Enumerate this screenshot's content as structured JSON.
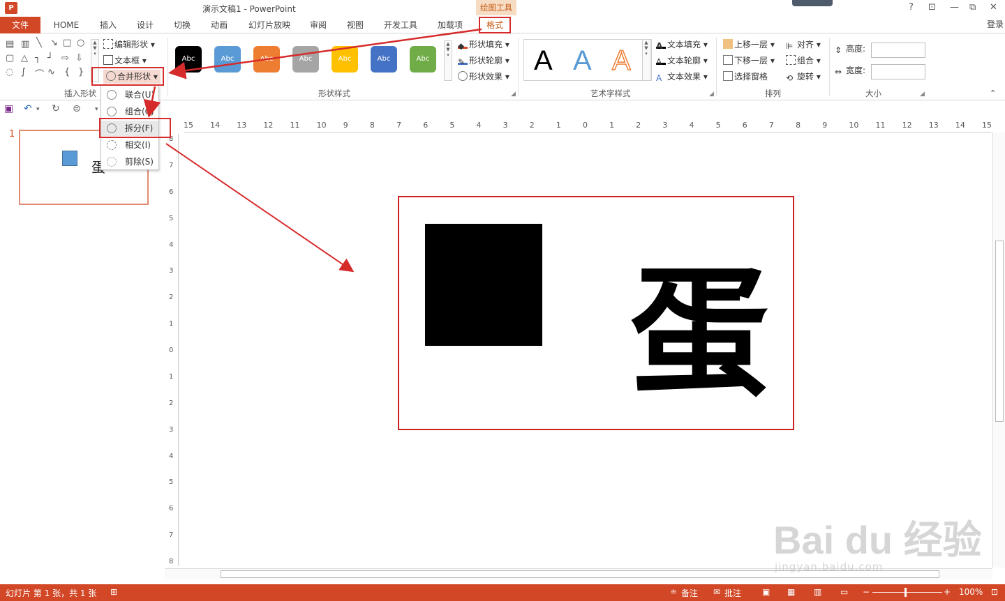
{
  "app": {
    "window_title": "演示文稿1 - PowerPoint",
    "context_tool_label": "绘图工具",
    "login": "登录",
    "logo_letter": "P",
    "help": "?",
    "restore": "⊡",
    "minimize": "—",
    "maximize": "⧉",
    "close": "✕"
  },
  "tabs": [
    {
      "label": "文件"
    },
    {
      "label": "HOME"
    },
    {
      "label": "插入"
    },
    {
      "label": "设计"
    },
    {
      "label": "切换"
    },
    {
      "label": "动画"
    },
    {
      "label": "幻灯片放映"
    },
    {
      "label": "审阅"
    },
    {
      "label": "视图"
    },
    {
      "label": "开发工具"
    },
    {
      "label": "加载项"
    },
    {
      "label": "格式"
    }
  ],
  "ribbon": {
    "insert_shapes": {
      "label": "插入形状",
      "edit_shape": "编辑形状",
      "text_box": "文本框",
      "merge_shapes": "合并形状"
    },
    "shape_styles": {
      "label": "形状样式",
      "swatch_text": "Abc",
      "swatches": [
        "#000000",
        "#5b9bd5",
        "#ed7d31",
        "#a5a5a5",
        "#ffc000",
        "#4472c4",
        "#70ad47"
      ],
      "fill": "形状填充",
      "outline": "形状轮廓",
      "effects": "形状效果"
    },
    "wordart": {
      "label": "艺术字样式",
      "letter": "A",
      "text_fill": "文本填充",
      "text_outline": "文本轮廓",
      "text_effects": "文本效果"
    },
    "arrange": {
      "label": "排列",
      "bring_forward": "上移一层",
      "send_backward": "下移一层",
      "selection_pane": "选择窗格",
      "align": "对齐",
      "group": "组合",
      "rotate": "旋转"
    },
    "size": {
      "label": "大小",
      "height": "高度:",
      "width": "宽度:"
    }
  },
  "merge_menu": [
    {
      "label": "联合(U)"
    },
    {
      "label": "组合(C)"
    },
    {
      "label": "拆分(F)"
    },
    {
      "label": "相交(I)"
    },
    {
      "label": "剪除(S)"
    }
  ],
  "thumbnails": {
    "slide_number": "1",
    "char": "蛋"
  },
  "slide": {
    "char": "蛋"
  },
  "rulers": {
    "horizontal": [
      "15",
      "14",
      "13",
      "12",
      "11",
      "10",
      "9",
      "8",
      "7",
      "6",
      "5",
      "4",
      "3",
      "2",
      "1",
      "0",
      "1",
      "2",
      "3",
      "4",
      "5",
      "6",
      "7",
      "8",
      "9",
      "10",
      "11",
      "12",
      "13",
      "14",
      "15"
    ],
    "vertical": [
      "8",
      "7",
      "6",
      "5",
      "4",
      "3",
      "2",
      "1",
      "0",
      "1",
      "2",
      "3",
      "4",
      "5",
      "6",
      "7",
      "8"
    ]
  },
  "status": {
    "slide_info": "幻灯片 第 1 张，共 1 张",
    "notes": "备注",
    "comments": "批注",
    "zoom": "100%"
  },
  "watermark": {
    "logo": "Bai du 经验",
    "url": "jingyan.baidu.com"
  },
  "colors": {
    "accent": "#d24726",
    "annotation": "#d62b2b",
    "context_tab": "#c55a11"
  }
}
